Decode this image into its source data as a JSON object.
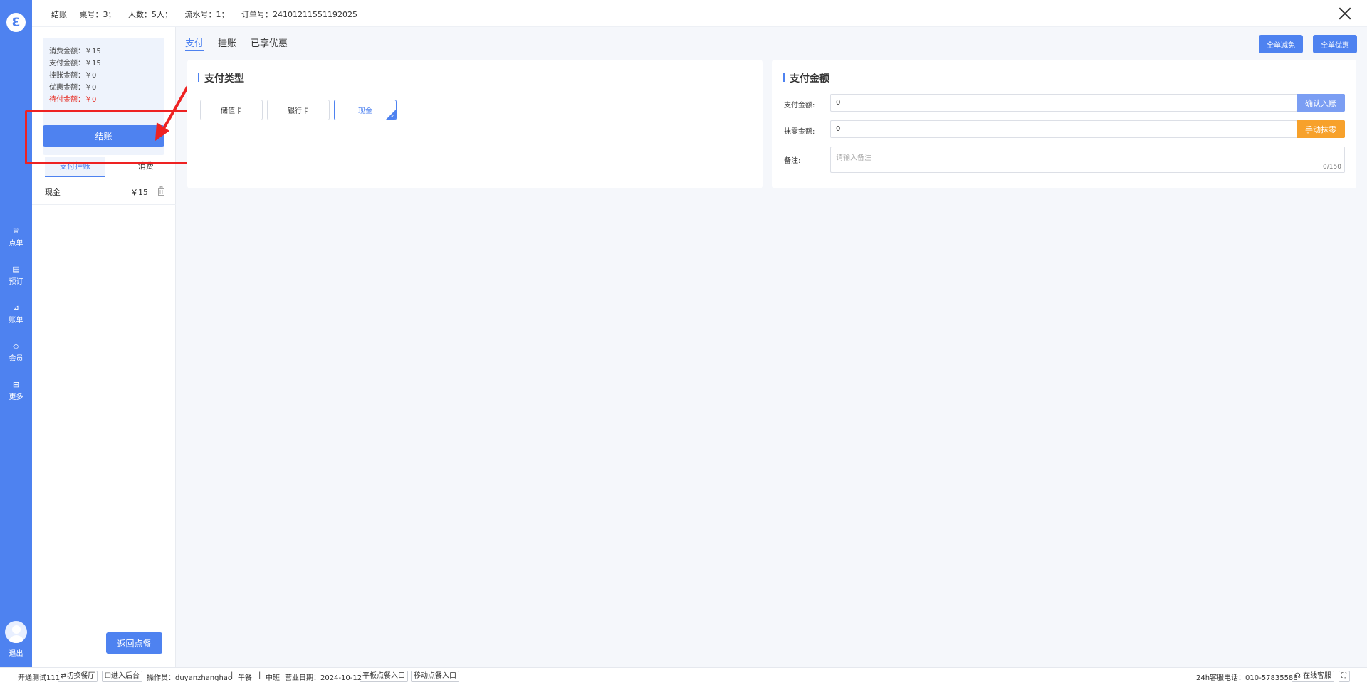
{
  "rail": {
    "logo": "Ɛ",
    "items": [
      {
        "label": "点单",
        "icon": "chef-hat-icon",
        "glyph": "♕"
      },
      {
        "label": "预订",
        "icon": "calendar-icon",
        "glyph": "▤"
      },
      {
        "label": "账单",
        "icon": "chart-icon",
        "glyph": "⊿"
      },
      {
        "label": "会员",
        "icon": "diamond-icon",
        "glyph": "◇"
      },
      {
        "label": "更多",
        "icon": "grid-icon",
        "glyph": "⊞"
      }
    ],
    "logout": "退出"
  },
  "header": {
    "title": "结账",
    "table": "桌号：3；",
    "people": "人数：5人；",
    "serial": "流水号：1；",
    "order": "订单号：24101211551192025"
  },
  "summary": {
    "consume": "消费金额：￥15",
    "paid": "支付金额：￥15",
    "credit": "挂账金额：￥0",
    "discount": "优惠金额：￥0",
    "due": "待付金额：￥0"
  },
  "checkout_label": "结账",
  "subtabs": [
    "支付挂账",
    "消费"
  ],
  "payments": [
    {
      "name": "现金",
      "amount": "￥15"
    }
  ],
  "back_label": "返回点餐",
  "main_tabs": [
    "支付",
    "挂账",
    "已享优惠"
  ],
  "top_buttons": {
    "reduce": "全单减免",
    "discount": "全单优惠"
  },
  "pay_type": {
    "title": "支付类型",
    "options": [
      "储值卡",
      "银行卡",
      "现金"
    ],
    "selected": "现金"
  },
  "pay_amount": {
    "title": "支付金额",
    "amount_label": "支付金额:",
    "amount_value": "0",
    "confirm_label": "确认入账",
    "round_label": "抹零金额:",
    "round_value": "0",
    "round_btn": "手动抹零",
    "note_label": "备注:",
    "note_placeholder": "请输入备注",
    "note_count": "0/150"
  },
  "footer": {
    "store": "开通测试111",
    "switch": "⇄切换餐厅",
    "backend": "☐进入后台",
    "operator": "操作员：duyanzhanghao",
    "sep1": "|",
    "meal": "午餐",
    "sep2": "|",
    "shift": "中班",
    "date": "营业日期：2024-10-12",
    "tablet": "平板点餐入口",
    "mobile": "移动点餐入口",
    "hotline": "24h客服电话：010-57835586",
    "online": "在线客服"
  },
  "colors": {
    "primary": "#4e82f0",
    "warning": "#f7a12b",
    "danger": "#e6281e",
    "annotation": "#ee2222"
  }
}
